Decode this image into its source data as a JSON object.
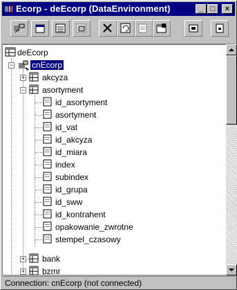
{
  "window": {
    "title": "Ecorp - deEcorp (DataEnvironment)",
    "controls": [
      "_",
      "□",
      "×"
    ]
  },
  "toolbar": {
    "buttons": [
      {
        "name": "add-connection-icon"
      },
      {
        "name": "add-command-icon"
      },
      {
        "name": "insert-stored-procedures-icon"
      },
      {
        "name": "add-child-command-icon"
      },
      {
        "name": "delete-icon"
      },
      {
        "name": "refresh-icon"
      },
      {
        "name": "design-icon"
      },
      {
        "name": "properties-icon"
      },
      {
        "name": "view-code-icon"
      },
      {
        "name": "options-icon"
      }
    ]
  },
  "tree": {
    "root": "deEcorp",
    "connection": "cnEcorp",
    "nodes": {
      "akcyza": "akcyza",
      "asortyment": "asortyment",
      "fields": [
        "id_asortyment",
        "asortyment",
        "id_vat",
        "id_akcyza",
        "id_miara",
        "index",
        "subindex",
        "id_grupa",
        "id_sww",
        "id_kontrahent",
        "opakowanie_zwrotne",
        "stempel_czasowy"
      ],
      "bank": "bank",
      "partial": "bzmr"
    }
  },
  "status": {
    "text": "Connection:  cnEcorp  (not connected)"
  }
}
